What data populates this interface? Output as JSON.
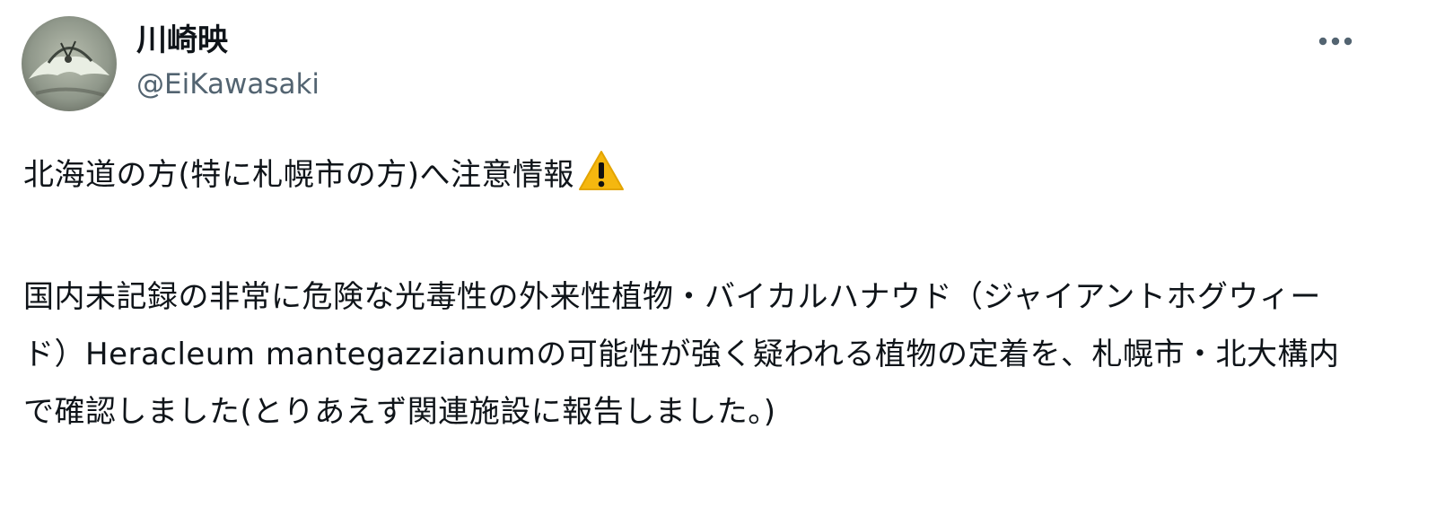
{
  "tweet": {
    "author": {
      "display_name": "川崎映",
      "handle": "@EiKawasaki"
    },
    "icons": {
      "more": "more-horizontal-icon",
      "warning": "warning-icon"
    },
    "body": {
      "line1": "北海道の方(特に札幌市の方)へ注意情報",
      "paragraph2": "国内未記録の非常に危険な光毒性の外来性植物・バイカルハナウド（ジャイアントホグウィード）Heracleum mantegazzianumの可能性が強く疑われる植物の定着を、札幌市・北大構内で確認しました(とりあえず関連施設に報告しました。)"
    },
    "colors": {
      "text": "#0f1419",
      "secondary": "#536471",
      "warning": "#f5b70f"
    }
  }
}
